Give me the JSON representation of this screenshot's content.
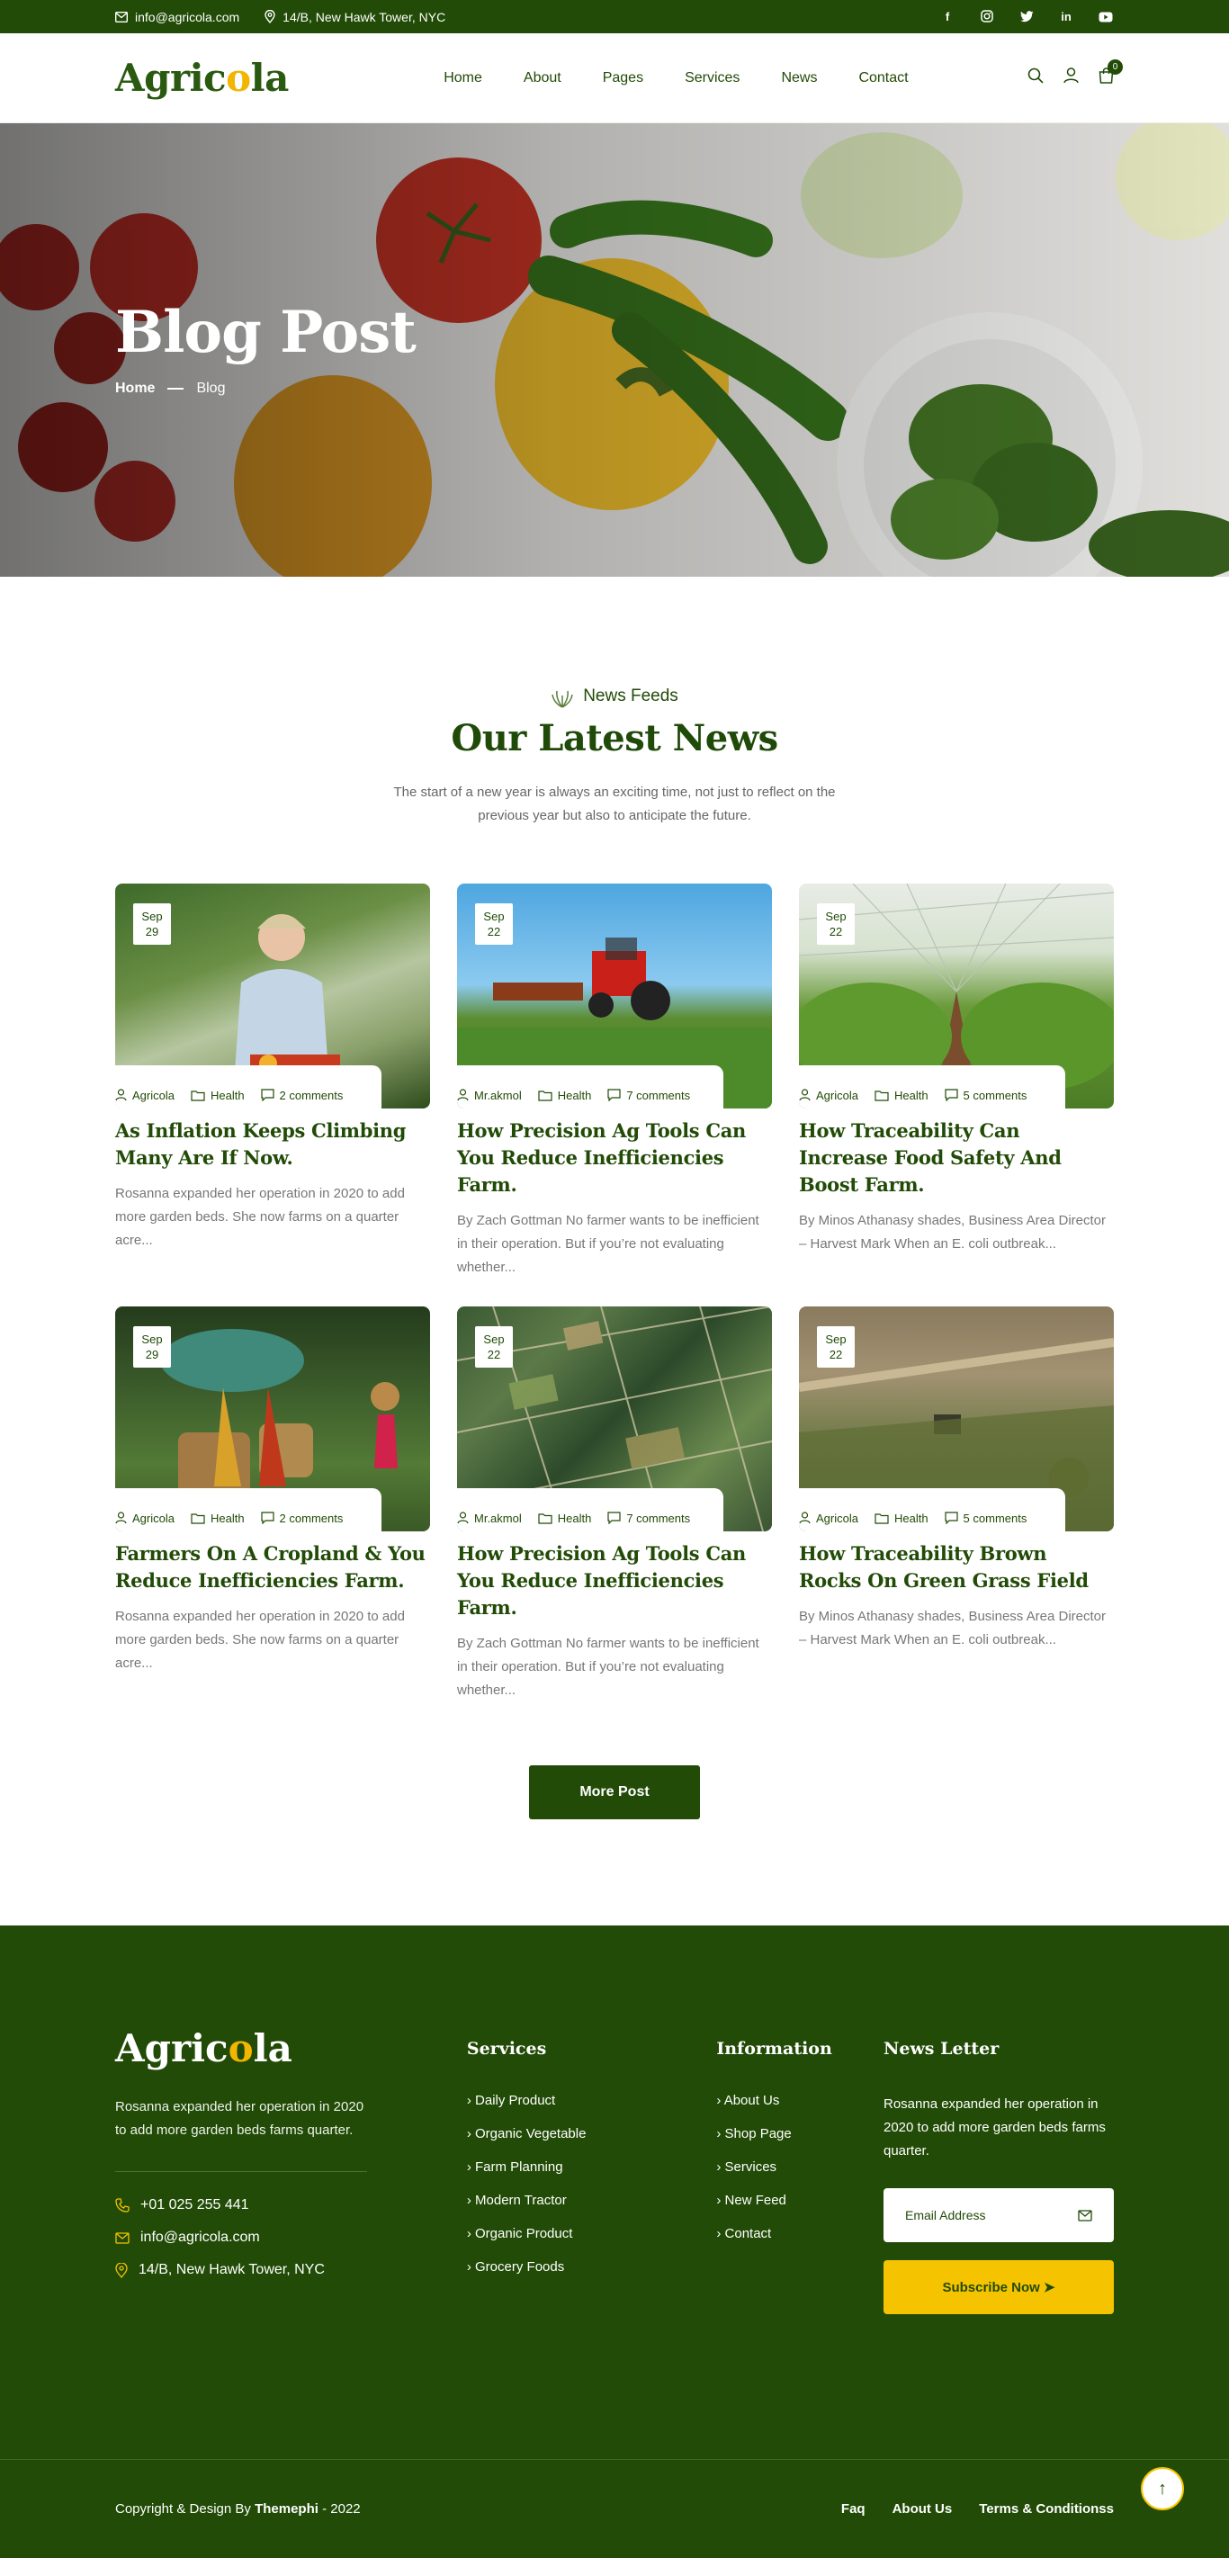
{
  "topbar": {
    "email": "info@agricola.com",
    "address": "14/B, New Hawk Tower, NYC",
    "socials": [
      "facebook-icon",
      "instagram-icon",
      "twitter-icon",
      "linkedin-icon",
      "youtube-icon"
    ]
  },
  "header": {
    "logo_left": "Agric",
    "logo_o": "o",
    "logo_right": "la",
    "nav": [
      "Home",
      "About",
      "Pages",
      "Services",
      "News",
      "Contact"
    ],
    "cart_count": "0"
  },
  "hero": {
    "title": "Blog Post",
    "crumb_home": "Home",
    "crumb_current": "Blog"
  },
  "news": {
    "kicker": "News Feeds",
    "title": "Our Latest News",
    "desc": "The start of a new year is always an exciting time, not just to reflect on the previous year but also to anticipate the future.",
    "posts": [
      {
        "month": "Sep",
        "day": "29",
        "author": "Agricola",
        "category": "Health",
        "comments": "2 comments",
        "title": "As Inflation Keeps Climbing Many Are If Now.",
        "excerpt": "Rosanna expanded her operation in 2020 to add more garden beds. She now farms on a quarter acre..."
      },
      {
        "month": "Sep",
        "day": "22",
        "author": "Mr.akmol",
        "category": "Health",
        "comments": "7 comments",
        "title": "How Precision Ag Tools Can You Reduce Inefficiencies Farm.",
        "excerpt": "By Zach Gottman No farmer wants to be inefficient in their operation. But if you’re not evaluating whether..."
      },
      {
        "month": "Sep",
        "day": "22",
        "author": "Agricola",
        "category": "Health",
        "comments": "5 comments",
        "title": "How Traceability Can Increase Food Safety And Boost Farm.",
        "excerpt": "By Minos Athanasy shades, Business Area Director – Harvest Mark When an E. coli outbreak..."
      },
      {
        "month": "Sep",
        "day": "29",
        "author": "Agricola",
        "category": "Health",
        "comments": "2 comments",
        "title": "Farmers On A Cropland & You Reduce Inefficiencies Farm.",
        "excerpt": "Rosanna expanded her operation in 2020 to add more garden beds. She now farms on a quarter acre..."
      },
      {
        "month": "Sep",
        "day": "22",
        "author": "Mr.akmol",
        "category": "Health",
        "comments": "7 comments",
        "title": "How Precision Ag Tools Can You Reduce Inefficiencies Farm.",
        "excerpt": "By Zach Gottman No farmer wants to be inefficient in their operation. But if you’re not evaluating whether..."
      },
      {
        "month": "Sep",
        "day": "22",
        "author": "Agricola",
        "category": "Health",
        "comments": "5 comments",
        "title": "How Traceability Brown Rocks On Green Grass Field",
        "excerpt": "By Minos Athanasy shades, Business Area Director – Harvest Mark When an E. coli outbreak..."
      }
    ],
    "more_label": "More Post"
  },
  "footer": {
    "desc": "Rosanna expanded her operation in 2020 to add more garden beds farms quarter.",
    "phone": "+01 025 255 441",
    "email": "info@agricola.com",
    "address": "14/B, New Hawk Tower, NYC",
    "services_title": "Services",
    "services": [
      "Daily Product",
      "Organic Vegetable",
      "Farm Planning",
      "Modern Tractor",
      "Organic Product",
      "Grocery Foods"
    ],
    "info_title": "Information",
    "info": [
      "About Us",
      "Shop Page",
      "Services",
      "New Feed",
      "Contact"
    ],
    "newsletter_title": "News Letter",
    "newsletter_desc": "Rosanna expanded her operation in 2020 to add more garden beds farms quarter.",
    "email_placeholder": "Email Address",
    "subscribe_label": "Subscribe Now",
    "copyright_prefix": "Copyright & Design By",
    "copyright_brand": "Themephi",
    "copyright_suffix": "- 2022",
    "bottom_links": [
      "Faq",
      "About Us",
      "Terms & Conditionss"
    ]
  },
  "colors": {
    "primary": "#214b06",
    "accent": "#f6c300",
    "text_muted": "#777777"
  }
}
